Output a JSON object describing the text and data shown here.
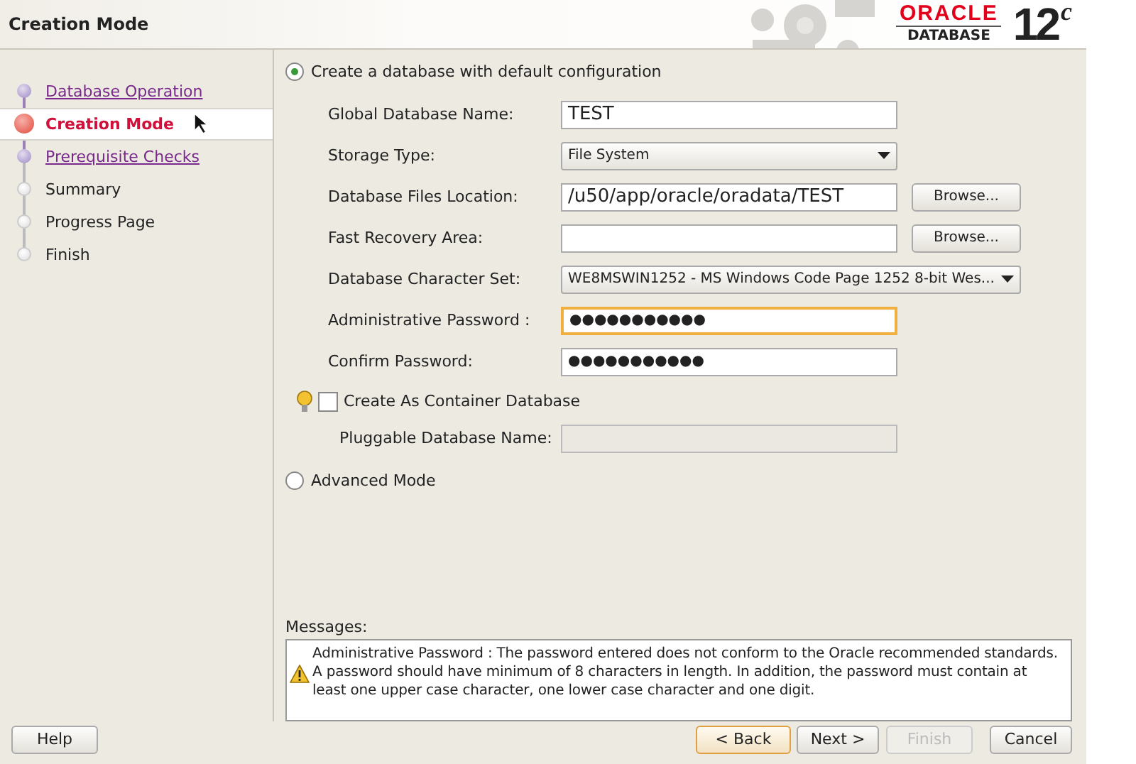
{
  "window": {
    "title": "Creation Mode"
  },
  "logo": {
    "brand": "ORACLE",
    "product": "DATABASE",
    "version": "12$^{c}$"
  },
  "steps": [
    {
      "label": "Database Operation",
      "visited": true,
      "selected": false
    },
    {
      "label": "Creation Mode",
      "visited": true,
      "selected": true
    },
    {
      "label": "Prerequisite Checks",
      "visited": true,
      "selected": false
    },
    {
      "label": "Summary",
      "visited": false,
      "selected": false
    },
    {
      "label": "Progress Page",
      "visited": false,
      "selected": false
    },
    {
      "label": "Finish",
      "visited": false,
      "selected": false
    }
  ],
  "default_mode": {
    "label": "Create a database with default configuration",
    "selected": true
  },
  "fields": [
    {
      "kind": "text",
      "label": "Global Database Name:",
      "value": "TEST",
      "focused": false
    },
    {
      "kind": "select",
      "label": "Storage Type:",
      "value": "File System"
    },
    {
      "kind": "text",
      "label": "Database Files Location:",
      "value": "/u50/app/oracle/oradata/TEST",
      "button": "Browse...",
      "focused": false
    },
    {
      "kind": "text",
      "label": "Fast Recovery Area:",
      "button": "Browse...",
      "focused": false
    },
    {
      "kind": "wide-select",
      "label": "Database Character Set:",
      "value": "WE8MSWIN1252 - MS Windows Code Page 1252 8-bit Wes..."
    },
    {
      "kind": "password",
      "label": "Administrative Password :",
      "value": "●●●●●●●●●●●",
      "focused": true
    },
    {
      "kind": "password",
      "label": "Confirm Password:",
      "value": "●●●●●●●●●●●",
      "focused": false
    }
  ],
  "container": {
    "label": "Create As Container Database",
    "checked": false
  },
  "pluggable": {
    "label": "Pluggable Database Name:",
    "disabled": true
  },
  "advanced_mode": {
    "label": "Advanced Mode",
    "selected": false
  },
  "messages": {
    "label": "Messages:",
    "kind": "warning",
    "text": "Administrative Password : The password entered does not conform to the Oracle recommended standards. A password should have minimum of 8 characters in length. In addition, the password must contain at least one upper case character, one lower case character and one digit."
  },
  "help_button": {
    "label": "Help"
  },
  "buttons": [
    {
      "label": "< Back",
      "default": true,
      "disabled": false
    },
    {
      "label": "Next >",
      "default": false,
      "disabled": false
    },
    {
      "label": "Finish",
      "default": false,
      "disabled": true
    },
    {
      "label": "Cancel",
      "default": false,
      "disabled": false
    }
  ]
}
